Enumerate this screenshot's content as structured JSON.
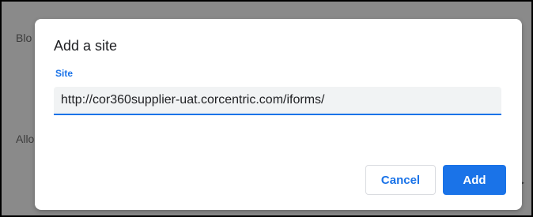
{
  "background": {
    "top_text": "Blo",
    "mid_text": "Allo",
    "chevron_glyph": "▸"
  },
  "dialog": {
    "title": "Add a site",
    "field_label": "Site",
    "site_value": "http://cor360supplier-uat.corcentric.com/iforms/",
    "cancel_label": "Cancel",
    "add_label": "Add"
  },
  "colors": {
    "accent": "#1a73e8",
    "overlay": "#8a8a8a"
  }
}
